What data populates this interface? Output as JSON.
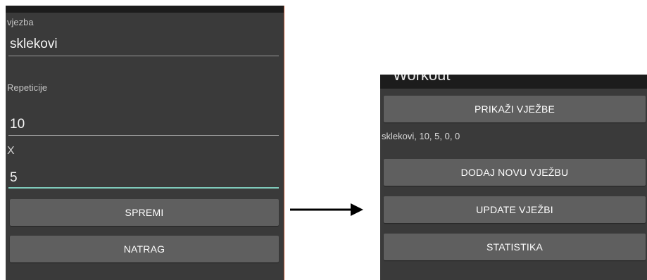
{
  "left": {
    "fields": [
      {
        "label": "vjezba",
        "value": "sklekovi"
      },
      {
        "label": "Repeticije",
        "value": "10"
      },
      {
        "label": "X",
        "value": "5"
      }
    ],
    "buttons": {
      "save": "SPREMI",
      "back": "NATRAG"
    },
    "active_accent": "#7fcabb"
  },
  "right": {
    "header_title": "Workout",
    "buttons": {
      "show": "PRIKAŽI VJEŽBE",
      "add": "DODAJ NOVU VJEŽBU",
      "update": "UPDATE VJEŽBI",
      "stats": "STATISTIKA"
    },
    "result_text": "sklekovi, 10, 5, 0, 0"
  },
  "arrow": "arrow-right-icon"
}
